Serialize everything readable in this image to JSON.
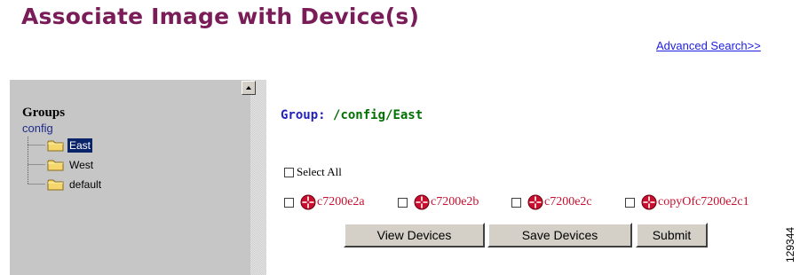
{
  "page": {
    "title": "Associate Image with Device(s)",
    "advanced_search": "Advanced Search>>"
  },
  "tree": {
    "heading": "Groups",
    "root": "config",
    "items": [
      {
        "label": "East",
        "selected": true
      },
      {
        "label": "West",
        "selected": false
      },
      {
        "label": "default",
        "selected": false
      }
    ]
  },
  "group": {
    "label": "Group:",
    "path": "/config/East"
  },
  "select_all": {
    "label": "Select All",
    "checked": false
  },
  "devices": [
    {
      "name": "c7200e2a",
      "checked": false,
      "icon": "router-icon"
    },
    {
      "name": "c7200e2b",
      "checked": false,
      "icon": "router-icon"
    },
    {
      "name": "c7200e2c",
      "checked": false,
      "icon": "router-icon"
    },
    {
      "name": "copyOfc7200e2c1",
      "checked": false,
      "icon": "router-icon"
    }
  ],
  "buttons": {
    "view": "View Devices",
    "save": "Save Devices",
    "submit": "Submit"
  },
  "figure_id": "129344",
  "colors": {
    "title": "#7a1c58",
    "link": "#1d1de0",
    "device_name": "#c8102e",
    "group_label": "#2222bb",
    "group_path": "#007000",
    "panel_bg": "#c6c6c6",
    "selection": "#0a246a"
  }
}
